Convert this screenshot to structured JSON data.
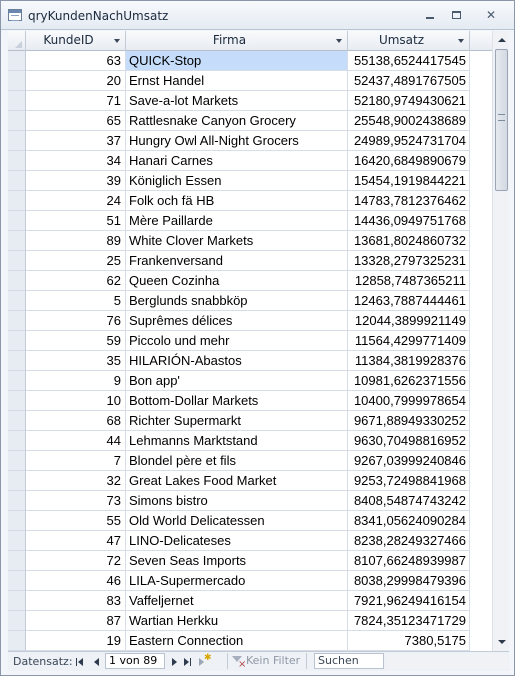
{
  "window": {
    "title": "qryKundenNachUmsatz"
  },
  "grid": {
    "columns": [
      {
        "label": "KundeID"
      },
      {
        "label": "Firma"
      },
      {
        "label": "Umsatz"
      }
    ],
    "rows": [
      {
        "id": "63",
        "firma": "QUICK-Stop",
        "umsatz": "55138,6524417545"
      },
      {
        "id": "20",
        "firma": "Ernst Handel",
        "umsatz": "52437,4891767505"
      },
      {
        "id": "71",
        "firma": "Save-a-lot Markets",
        "umsatz": "52180,9749430621"
      },
      {
        "id": "65",
        "firma": "Rattlesnake Canyon Grocery",
        "umsatz": "25548,9002438689"
      },
      {
        "id": "37",
        "firma": "Hungry Owl All-Night Grocers",
        "umsatz": "24989,9524731704"
      },
      {
        "id": "34",
        "firma": "Hanari Carnes",
        "umsatz": "16420,6849890679"
      },
      {
        "id": "39",
        "firma": "Königlich Essen",
        "umsatz": "15454,1919844221"
      },
      {
        "id": "24",
        "firma": "Folk och fä HB",
        "umsatz": "14783,7812376462"
      },
      {
        "id": "51",
        "firma": "Mère Paillarde",
        "umsatz": "14436,0949751768"
      },
      {
        "id": "89",
        "firma": "White Clover Markets",
        "umsatz": "13681,8024860732"
      },
      {
        "id": "25",
        "firma": "Frankenversand",
        "umsatz": "13328,2797325231"
      },
      {
        "id": "62",
        "firma": "Queen Cozinha",
        "umsatz": "12858,7487365211"
      },
      {
        "id": "5",
        "firma": "Berglunds snabbköp",
        "umsatz": "12463,7887444461"
      },
      {
        "id": "76",
        "firma": "Suprêmes délices",
        "umsatz": "12044,3899921149"
      },
      {
        "id": "59",
        "firma": "Piccolo und mehr",
        "umsatz": "11564,4299771409"
      },
      {
        "id": "35",
        "firma": "HILARIÓN-Abastos",
        "umsatz": "11384,3819928376"
      },
      {
        "id": "9",
        "firma": "Bon app'",
        "umsatz": "10981,6262371556"
      },
      {
        "id": "10",
        "firma": "Bottom-Dollar Markets",
        "umsatz": "10400,7999978654"
      },
      {
        "id": "68",
        "firma": "Richter Supermarkt",
        "umsatz": "9671,88949330252"
      },
      {
        "id": "44",
        "firma": "Lehmanns Marktstand",
        "umsatz": "9630,70498816952"
      },
      {
        "id": "7",
        "firma": "Blondel père et fils",
        "umsatz": "9267,03999240846"
      },
      {
        "id": "32",
        "firma": "Great Lakes Food Market",
        "umsatz": "9253,72498841968"
      },
      {
        "id": "73",
        "firma": "Simons bistro",
        "umsatz": "8408,54874743242"
      },
      {
        "id": "55",
        "firma": "Old World Delicatessen",
        "umsatz": "8341,05624090284"
      },
      {
        "id": "47",
        "firma": "LINO-Delicateses",
        "umsatz": "8238,28249327466"
      },
      {
        "id": "72",
        "firma": "Seven Seas Imports",
        "umsatz": "8107,66248939987"
      },
      {
        "id": "46",
        "firma": "LILA-Supermercado",
        "umsatz": "8038,29998479396"
      },
      {
        "id": "83",
        "firma": "Vaffeljernet",
        "umsatz": "7921,96249416154"
      },
      {
        "id": "87",
        "firma": "Wartian Herkku",
        "umsatz": "7824,35123471729"
      },
      {
        "id": "19",
        "firma": "Eastern Connection",
        "umsatz": "7380,5175"
      }
    ]
  },
  "statusbar": {
    "label": "Datensatz:",
    "record": "1 von 89",
    "filter_label": "Kein Filter",
    "search_placeholder": "Suchen"
  },
  "colors": {
    "selected_cell": "#c5ddfa",
    "header_bg": "#e8ecf2",
    "window_border": "#8a97a9"
  }
}
